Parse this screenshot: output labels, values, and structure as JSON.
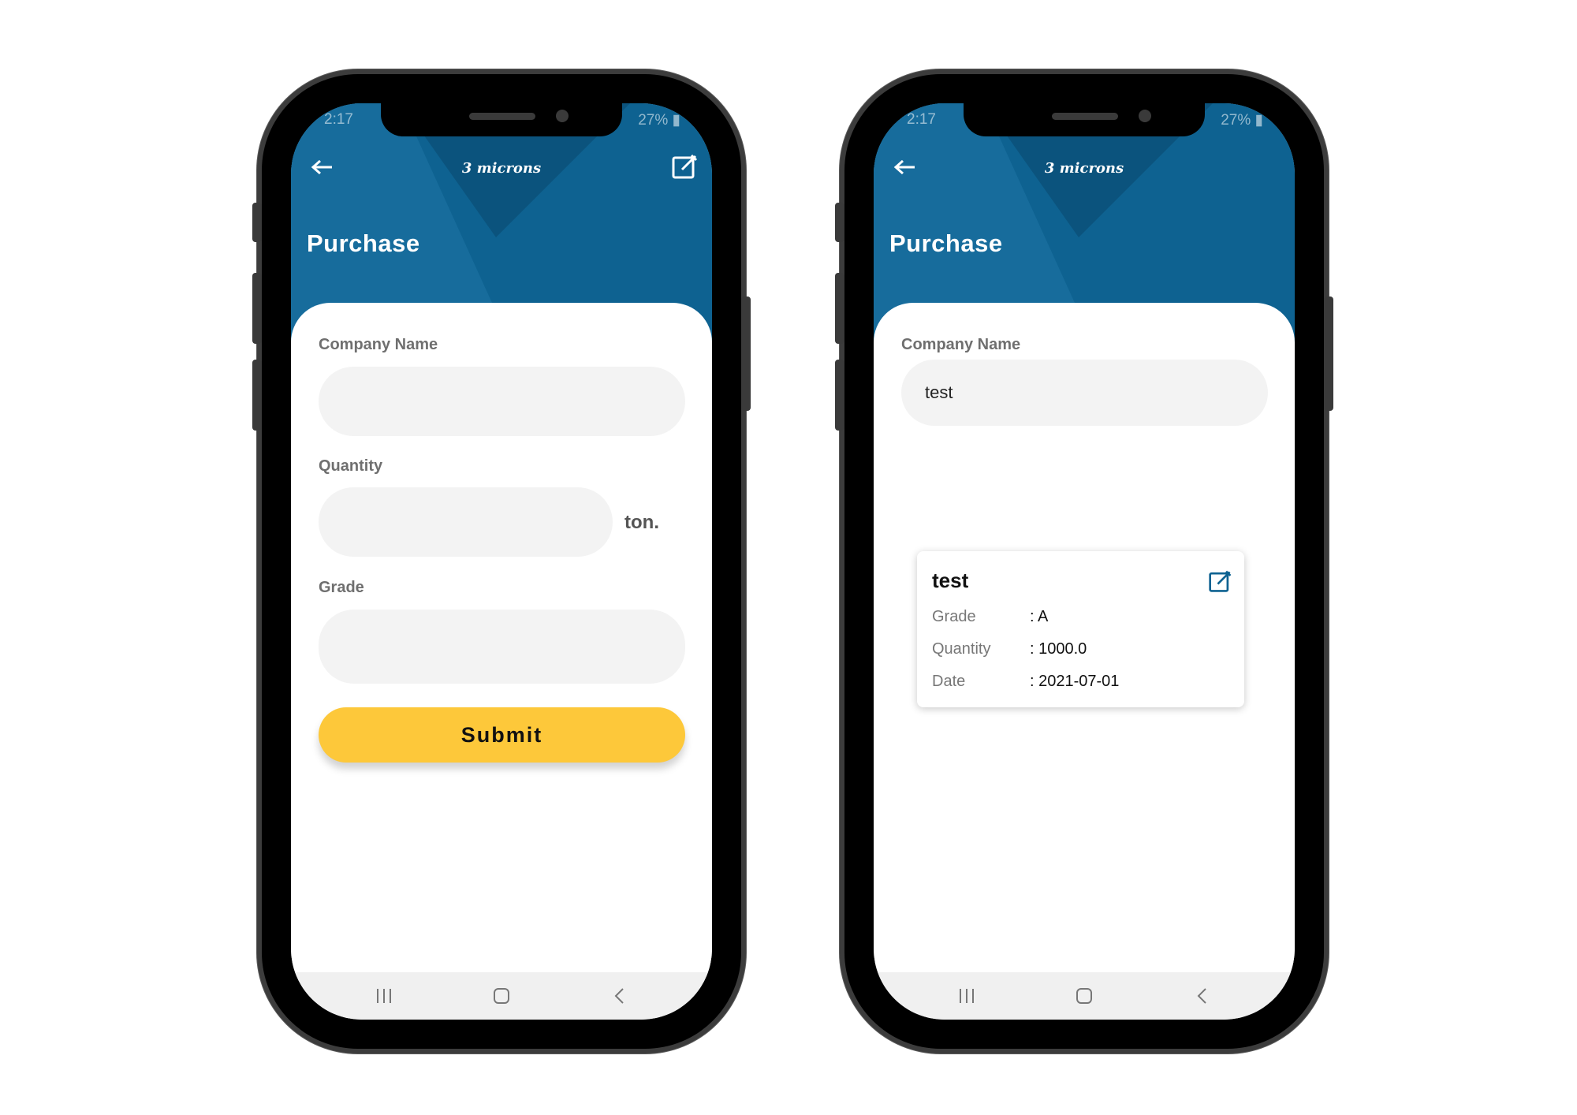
{
  "colors": {
    "header_blue": "#0e6291",
    "submit_yellow": "#fdc83a",
    "field_gray": "#f3f3f3"
  },
  "status_bar": {
    "time": "2:17",
    "battery": "27%"
  },
  "header": {
    "brand": "3 microns",
    "title": "Purchase"
  },
  "form_screen": {
    "company_label": "Company Name",
    "company_value": "",
    "quantity_label": "Quantity",
    "quantity_value": "",
    "quantity_unit": "ton.",
    "grade_label": "Grade",
    "grade_value": "",
    "submit_label": "Submit"
  },
  "search_screen": {
    "company_label": "Company Name",
    "company_value": "test",
    "result_card": {
      "title": "test",
      "rows": [
        {
          "key": "Grade",
          "value": ": A"
        },
        {
          "key": "Quantity",
          "value": ": 1000.0"
        },
        {
          "key": "Date",
          "value": ": 2021-07-01"
        }
      ]
    }
  },
  "icons": {
    "back": "arrow-left-icon",
    "edit": "edit-square-icon",
    "recents": "recents-icon",
    "home": "home-icon",
    "nav_back": "chevron-left-icon"
  }
}
